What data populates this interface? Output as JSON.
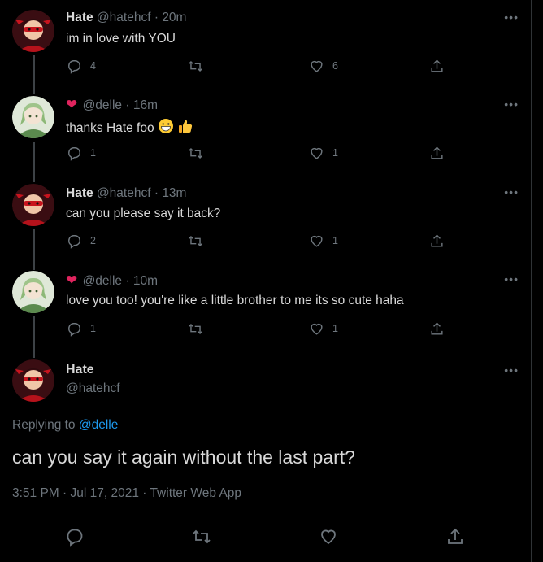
{
  "tweets": [
    {
      "name": "Hate",
      "handle": "@hatehcf",
      "dot": "·",
      "time": "20m",
      "text": "im in love with YOU",
      "replies": "4",
      "retweets": "",
      "likes": "6",
      "badge": false
    },
    {
      "name": "",
      "handle": "@delle",
      "dot": "·",
      "time": "16m",
      "text": "thanks Hate foo",
      "replies": "1",
      "retweets": "",
      "likes": "1",
      "badge": true
    },
    {
      "name": "Hate",
      "handle": "@hatehcf",
      "dot": "·",
      "time": "13m",
      "text": "can you please say it back?",
      "replies": "2",
      "retweets": "",
      "likes": "1",
      "badge": false
    },
    {
      "name": "",
      "handle": "@delle",
      "dot": "·",
      "time": "10m",
      "text": "love you too! you're like a little brother to me its so cute haha",
      "replies": "1",
      "retweets": "",
      "likes": "1",
      "badge": true
    }
  ],
  "focus": {
    "name": "Hate",
    "handle": "@hatehcf",
    "replying_prefix": "Replying to ",
    "replying_to": "@delle",
    "text": "can you say it again without the last part?",
    "meta": "3:51 PM · Jul 17, 2021 · Twitter Web App"
  },
  "icons": {
    "more": "more-icon",
    "reply": "reply-icon",
    "retweet": "retweet-icon",
    "like": "like-icon",
    "share": "share-icon",
    "heart_badge": "heart-icon",
    "emoji_grin": "grin-emoji",
    "emoji_thumb": "thumbs-up-emoji"
  },
  "colors": {
    "background": "#000000",
    "text": "#d9d9d9",
    "muted": "#6e767d",
    "link": "#1d9bf0",
    "heart": "#e0245e"
  }
}
